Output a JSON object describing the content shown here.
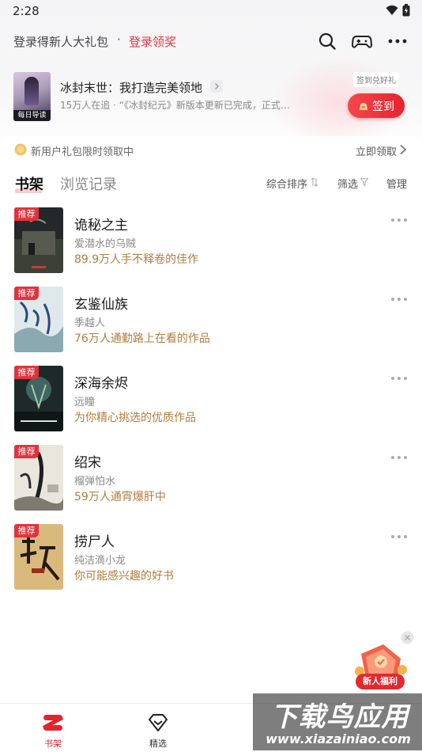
{
  "status_bar": {
    "time": "2:28"
  },
  "header": {
    "login_prompt": "登录得新人大礼包",
    "separator": "·",
    "login_link": "登录领奖",
    "accent_color": "#e8353f"
  },
  "featured": {
    "cover_label": "每日导读",
    "title": "冰封末世：我打造完美领地",
    "subtitle": "15万人在追 · “《冰封纪元》新版本更新已完成，正式…",
    "checkin_hint": "签到兑好礼",
    "checkin_label": "签到"
  },
  "notice": {
    "text": "新用户礼包限时领取中",
    "link": "立即领取"
  },
  "tabs": {
    "shelf": "书架",
    "history": "浏览记录",
    "sort": "综合排序",
    "filter": "筛选",
    "manage": "管理"
  },
  "recommend_badge": "推荐",
  "books": [
    {
      "title": "诡秘之主",
      "author": "爱潜水的乌贼",
      "tag": "89.9万人手不释卷的佳作"
    },
    {
      "title": "玄鉴仙族",
      "author": "季越人",
      "tag": "76万人通勤路上在看的作品"
    },
    {
      "title": "深海余烬",
      "author": "远瞳",
      "tag": "为你精心挑选的优质作品"
    },
    {
      "title": "绍宋",
      "author": "榴弹怕水",
      "tag": "59万人通宵爆肝中"
    },
    {
      "title": "捞尸人",
      "author": "纯洁滴小龙",
      "tag": "你可能感兴趣的好书"
    }
  ],
  "float_promo": {
    "label": "新人福利"
  },
  "bottom_nav": {
    "items": [
      {
        "label": "书架",
        "active": true
      },
      {
        "label": "精选",
        "active": false
      }
    ],
    "active_color": "#e3242e"
  },
  "watermark": {
    "title": "下载鸟应用",
    "url": "www.xiazainiao.com"
  }
}
